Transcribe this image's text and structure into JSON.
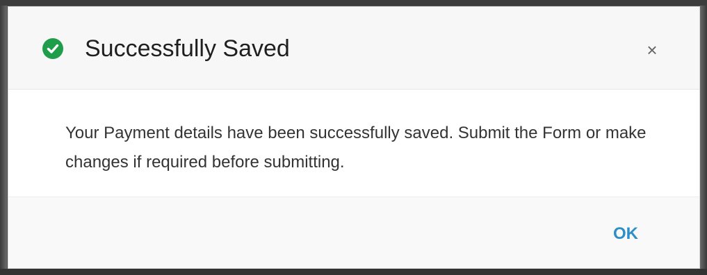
{
  "dialog": {
    "title": "Successfully Saved",
    "status_icon": "check-circle-icon",
    "close_icon": "close-icon",
    "close_glyph": "×",
    "message": "Your Payment details have been successfully saved. Submit the Form or make changes if required before submitting.",
    "ok_label": "OK"
  },
  "colors": {
    "success": "#1e9e4a",
    "accent": "#2e8fc7",
    "header_bg": "#f7f7f7",
    "footer_bg": "#f9f9f9",
    "backdrop": "#4a4a4a"
  }
}
